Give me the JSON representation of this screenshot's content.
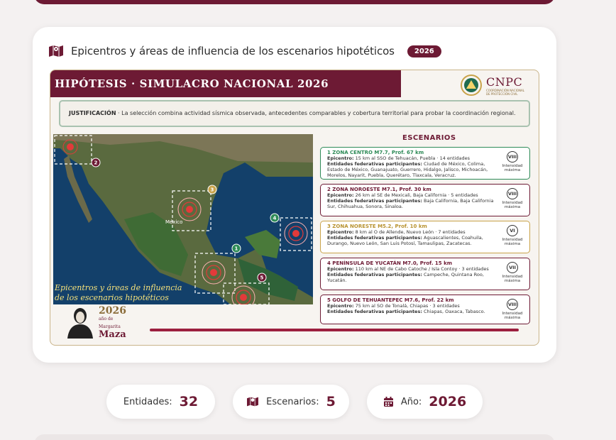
{
  "card": {
    "title": "Epicentros y áreas de influencia de los escenarios hipotéticos",
    "year_badge": "2026"
  },
  "poster": {
    "banner": "HIPÓTESIS · SIMULACRO NACIONAL 2026",
    "cnpc": "CNPC",
    "cnpc_sub1": "COORDINACIÓN NACIONAL",
    "cnpc_sub2": "DE PROTECCIÓN CIVIL",
    "justification_label": "JUSTIFICACIÓN",
    "justification_text": " · La selección combina actividad sísmica observada, antecedentes comparables y cobertura territorial para probar la coordinación regional.",
    "map_caption_line1": "Epicentros y áreas de influencia",
    "map_caption_line2": "de los escenarios hipotéticos",
    "map_city": "México",
    "scenarios_title": "ESCENARIOS",
    "epicentro_label": "Epicentro:",
    "entidades_label": "Entidades federativas participantes:",
    "intensity_label1": "Intensidad",
    "intensity_label2": "máxima",
    "scenarios": [
      {
        "number": "1",
        "head": "1  ZONA CENTRO   M7.7, Prof. 67 km",
        "epicentro": " 15 km al SSO de Tehuacán, Puebla · 14 entidades",
        "entidades": " Ciudad de México, Colima, Estado de México, Guanajuato, Guerrero, Hidalgo, Jalisco, Michoacán, Morelos, Nayarit, Puebla, Querétaro, Tlaxcala, Veracruz.",
        "intensity": "VIII"
      },
      {
        "number": "2",
        "head": "2  ZONA NOROESTE   M7.1, Prof. 30 km",
        "epicentro": " 26 km al SE de Mexicali, Baja California · 5 entidades",
        "entidades": " Baja California, Baja California Sur, Chihuahua, Sonora, Sinaloa.",
        "intensity": "VIII"
      },
      {
        "number": "3",
        "head": "3  ZONA NORESTE   M5.2, Prof. 10 km",
        "epicentro": " 8 km al O de Allende, Nuevo León · 7 entidades",
        "entidades": " Aguascalientes, Coahuila, Durango, Nuevo León, San Luis Potosí, Tamaulipas, Zacatecas.",
        "intensity": "VI"
      },
      {
        "number": "4",
        "head": "4  PENÍNSULA DE YUCATÁN   M7.0, Prof. 15 km",
        "epicentro": " 110 km al NE de Cabo Catoche / Isla Contoy · 3 entidades",
        "entidades": " Campeche, Quintana Roo, Yucatán.",
        "intensity": "VII"
      },
      {
        "number": "5",
        "head": "5  GOLFO DE TEHUANTEPEC   M7.6, Prof. 22 km",
        "epicentro": " 75 km al SO de Tonalá, Chiapas · 3 entidades",
        "entidades": " Chiapas, Oaxaca, Tabasco.",
        "intensity": "VIII"
      }
    ],
    "maza_year": "2026",
    "maza_small1": "año de",
    "maza_small2": "Margarita",
    "maza_name": "Maza"
  },
  "stats": [
    {
      "label": "Entidades:",
      "value": "32",
      "icon": "none"
    },
    {
      "label": "Escenarios:",
      "value": "5",
      "icon": "map-icon"
    },
    {
      "label": "Año:",
      "value": "2026",
      "icon": "calendar-icon"
    }
  ],
  "colors": {
    "accent": "#6d1a34",
    "gold": "#8b6d3a",
    "map_ring": "#e23a3a"
  }
}
